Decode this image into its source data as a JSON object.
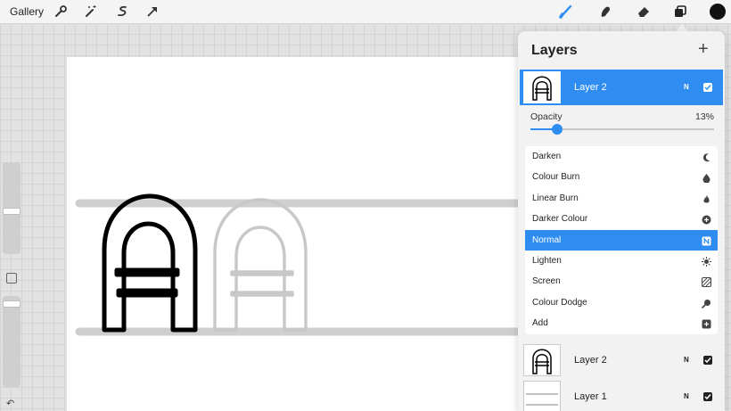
{
  "toolbar": {
    "gallery_label": "Gallery",
    "left_icons": [
      "wrench-icon",
      "magic-wand-icon",
      "selection-icon",
      "transform-arrow-icon"
    ],
    "right_icons": [
      "brush-icon",
      "smudge-icon",
      "eraser-icon",
      "layers-icon"
    ],
    "current_color": "#111111",
    "accent_color": "#2f8df2"
  },
  "sidebar": {
    "brush_size_level": 0.35,
    "opacity_level": 0.15
  },
  "layers_panel": {
    "title": "Layers",
    "active_layer": {
      "name": "Layer 2",
      "blend_mode_short": "N",
      "visible": true
    },
    "opacity": {
      "label": "Opacity",
      "value_text": "13%",
      "value": 0.13
    },
    "blend_modes": [
      {
        "label": "Darken",
        "icon": "moon-icon",
        "selected": false
      },
      {
        "label": "Colour Burn",
        "icon": "flame-drop-icon",
        "selected": false
      },
      {
        "label": "Linear Burn",
        "icon": "flame-icon",
        "selected": false
      },
      {
        "label": "Darker Colour",
        "icon": "plus-circle-icon",
        "selected": false
      },
      {
        "label": "Normal",
        "icon": "n-badge-icon",
        "selected": true,
        "badge": "N"
      },
      {
        "label": "Lighten",
        "icon": "sun-icon",
        "selected": false
      },
      {
        "label": "Screen",
        "icon": "hatch-icon",
        "selected": false
      },
      {
        "label": "Colour Dodge",
        "icon": "magnifier-icon",
        "selected": false
      },
      {
        "label": "Add",
        "icon": "plus-square-icon",
        "selected": false
      }
    ],
    "layers": [
      {
        "name": "Layer 2",
        "blend_mode_short": "N",
        "visible": true
      },
      {
        "name": "Layer 1",
        "blend_mode_short": "N",
        "visible": true
      }
    ]
  }
}
